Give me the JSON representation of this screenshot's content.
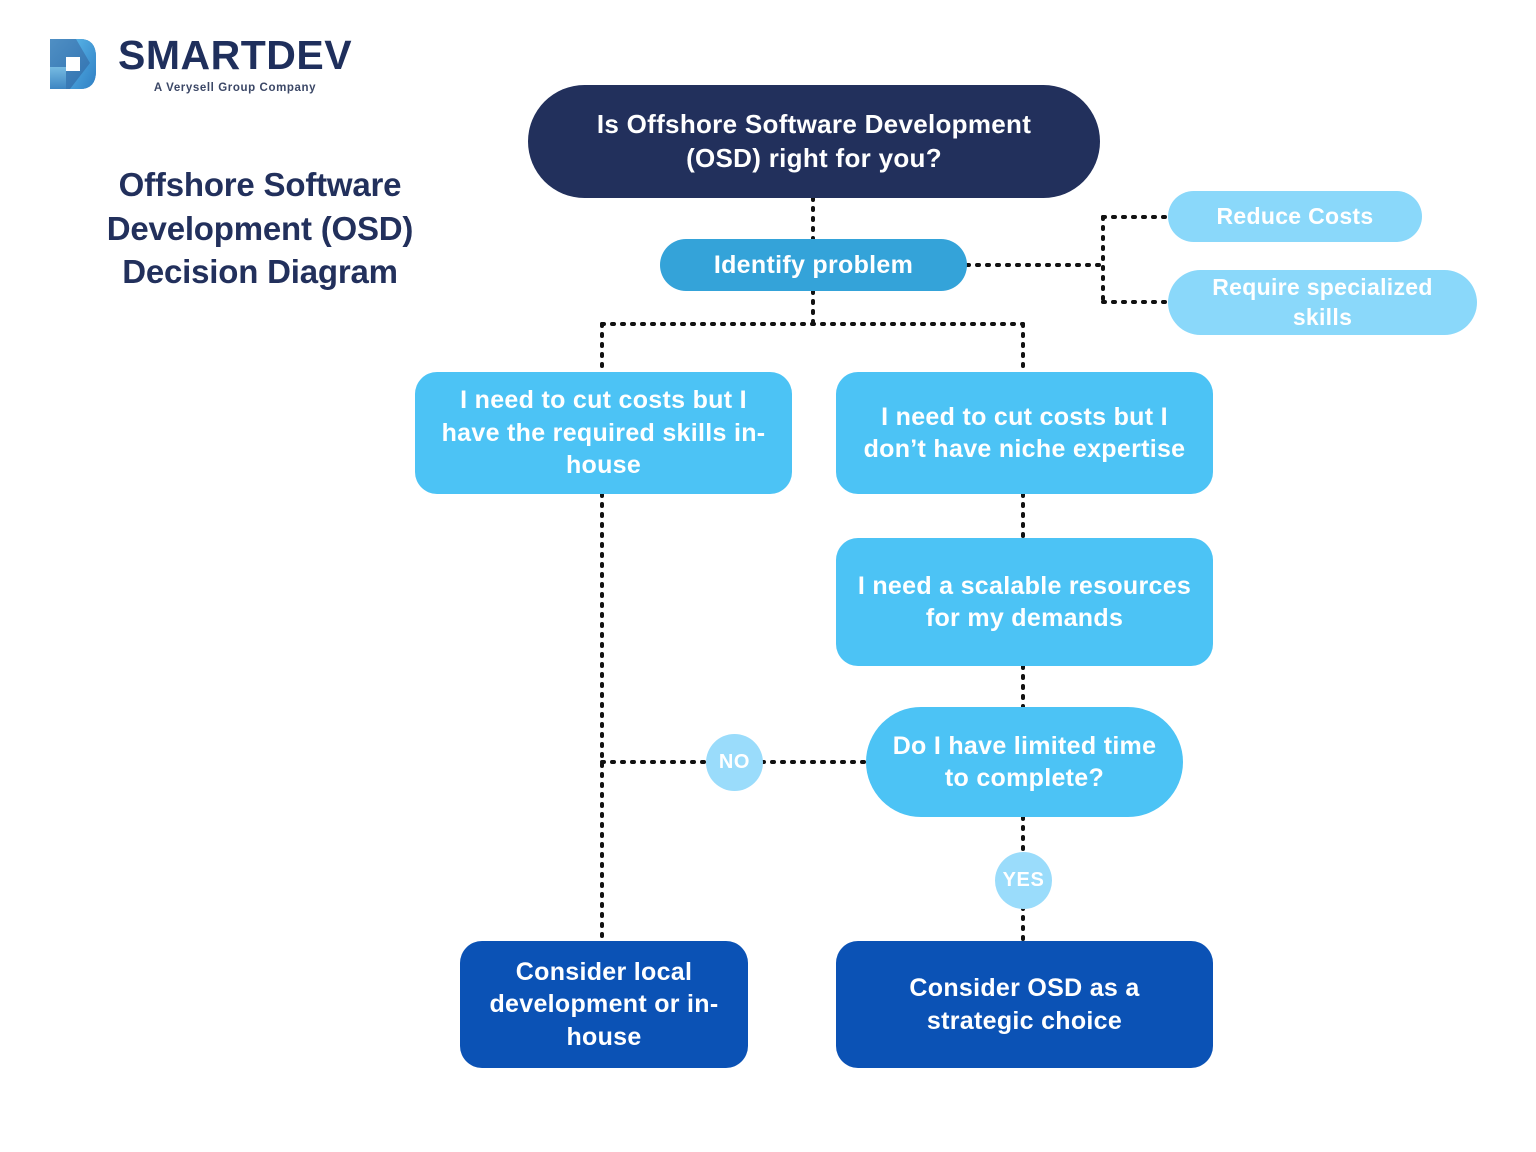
{
  "brand": {
    "logo_icon": "smartdev-d-logo",
    "name": "SMARTDEV",
    "tagline": "A Verysell Group Company"
  },
  "page": {
    "title": "Offshore Software Development (OSD) Decision Diagram"
  },
  "colors": {
    "navy": "#22305c",
    "medium_blue": "#34a3d9",
    "bright_blue": "#4cc3f5",
    "light_blue": "#8ad8fa",
    "deep_blue": "#0b52b5",
    "connector": "#111111",
    "background": "#ffffff"
  },
  "chart_data": {
    "type": "diagram",
    "title": "Offshore Software Development (OSD) Decision Diagram",
    "nodes": [
      {
        "id": "root",
        "label": "Is Offshore Software Development (OSD) right for you?",
        "kind": "root"
      },
      {
        "id": "identify",
        "label": "Identify problem",
        "kind": "step"
      },
      {
        "id": "reduce",
        "label": "Reduce Costs",
        "kind": "option"
      },
      {
        "id": "skills",
        "label": "Require specialized skills",
        "kind": "option"
      },
      {
        "id": "left1",
        "label": "I need to cut costs but I have the required skills in-house",
        "kind": "branch"
      },
      {
        "id": "right1",
        "label": "I need to cut costs but I don’t have niche expertise",
        "kind": "branch"
      },
      {
        "id": "right2",
        "label": "I need a scalable resources for my demands",
        "kind": "branch"
      },
      {
        "id": "question",
        "label": "Do I have limited time to complete?",
        "kind": "question"
      },
      {
        "id": "localdev",
        "label": "Consider local development or in-house",
        "kind": "outcome"
      },
      {
        "id": "osd",
        "label": "Consider OSD as a strategic choice",
        "kind": "outcome"
      }
    ],
    "edges": [
      {
        "from": "root",
        "to": "identify",
        "label": ""
      },
      {
        "from": "identify",
        "to": "reduce",
        "label": ""
      },
      {
        "from": "identify",
        "to": "skills",
        "label": ""
      },
      {
        "from": "identify",
        "to": "left1",
        "label": ""
      },
      {
        "from": "identify",
        "to": "right1",
        "label": ""
      },
      {
        "from": "right1",
        "to": "right2",
        "label": ""
      },
      {
        "from": "right2",
        "to": "question",
        "label": ""
      },
      {
        "from": "question",
        "to": "localdev",
        "label": "NO"
      },
      {
        "from": "question",
        "to": "osd",
        "label": "YES"
      }
    ],
    "edge_labels": {
      "no": "NO",
      "yes": "YES"
    }
  },
  "nodes": {
    "root": "Is Offshore Software Development (OSD) right for you?",
    "identify": "Identify problem",
    "reduce_costs": "Reduce Costs",
    "specialized_skills": "Require specialized skills",
    "left_branch": "I need to cut costs but I have the required skills in-house",
    "right_branch": "I need to cut costs but I don’t have niche expertise",
    "scalable": "I need a scalable resources for my demands",
    "question": "Do I have limited time to complete?",
    "outcome_local": "Consider local development or in-house",
    "outcome_osd": "Consider OSD as a strategic choice"
  },
  "badges": {
    "no": "NO",
    "yes": "YES"
  }
}
